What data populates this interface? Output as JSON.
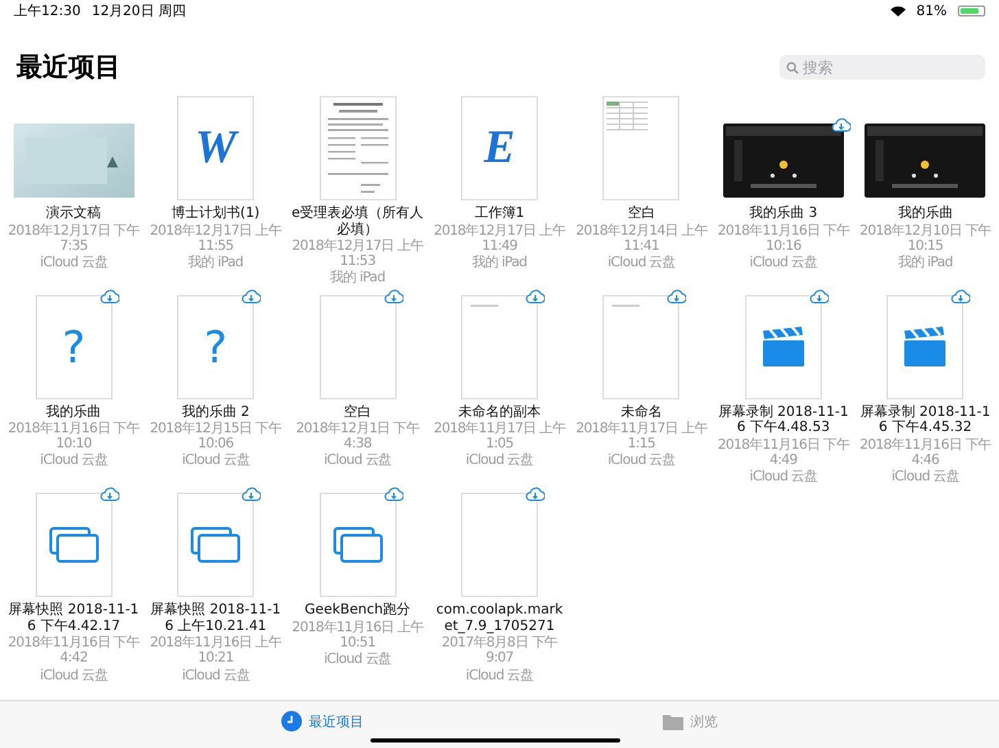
{
  "status_bar": {
    "time": "上午12:30",
    "date": "12月20日 周四",
    "battery_text": "81%"
  },
  "header": {
    "title": "最近项目",
    "search": {
      "placeholder": "搜索"
    }
  },
  "items": [
    {
      "name": "演示文稿",
      "date": "2018年12月17日 下午7:35",
      "location": "iCloud 云盘",
      "kind": "presentation",
      "cloud": false
    },
    {
      "name": "博士计划书(1)",
      "date": "2018年12月17日 上午11:55",
      "location": "我的 iPad",
      "kind": "letter",
      "glyph": "W",
      "cloud": false
    },
    {
      "name": "e受理表必填（所有人必填）",
      "date": "2018年12月17日 上午11:53",
      "location": "我的 iPad",
      "kind": "form",
      "cloud": false
    },
    {
      "name": "工作簿1",
      "date": "2018年12月17日 上午11:49",
      "location": "我的 iPad",
      "kind": "letter",
      "glyph": "E",
      "cloud": false
    },
    {
      "name": "空白",
      "date": "2018年12月14日 上午11:41",
      "location": "iCloud 云盘",
      "kind": "sheet",
      "cloud": false
    },
    {
      "name": "我的乐曲 3",
      "date": "2018年11月16日 下午10:16",
      "location": "iCloud 云盘",
      "kind": "music",
      "cloud": true
    },
    {
      "name": "我的乐曲",
      "date": "2018年12月10日 下午10:15",
      "location": "我的 iPad",
      "kind": "music",
      "cloud": false
    },
    {
      "name": "我的乐曲",
      "date": "2018年11月16日 下午10:10",
      "location": "iCloud 云盘",
      "kind": "unknown",
      "glyph": "?",
      "cloud": true
    },
    {
      "name": "我的乐曲 2",
      "date": "2018年12月15日 下午10:06",
      "location": "iCloud 云盘",
      "kind": "unknown",
      "glyph": "?",
      "cloud": true
    },
    {
      "name": "空白",
      "date": "2018年12月1日 下午4:38",
      "location": "iCloud 云盘",
      "kind": "blank",
      "cloud": true
    },
    {
      "name": "未命名的副本",
      "date": "2018年11月17日 上午1:05",
      "location": "iCloud 云盘",
      "kind": "note",
      "cloud": true
    },
    {
      "name": "未命名",
      "date": "2018年11月17日 上午1:15",
      "location": "iCloud 云盘",
      "kind": "note",
      "cloud": true
    },
    {
      "name": "屏幕录制 2018-11-16 下午4.48.53",
      "date": "2018年11月16日 下午4:49",
      "location": "iCloud 云盘",
      "kind": "video",
      "cloud": true
    },
    {
      "name": "屏幕录制 2018-11-16 下午4.45.32",
      "date": "2018年11月16日 下午4:46",
      "location": "iCloud 云盘",
      "kind": "video",
      "cloud": true
    },
    {
      "name": "屏幕快照 2018-11-16 下午4.42.17",
      "date": "2018年11月16日 下午4:42",
      "location": "iCloud 云盘",
      "kind": "image",
      "cloud": true
    },
    {
      "name": "屏幕快照 2018-11-16 上午10.21.41",
      "date": "2018年11月16日 上午10:21",
      "location": "iCloud 云盘",
      "kind": "image",
      "cloud": true
    },
    {
      "name": "GeekBench跑分",
      "date": "2018年11月16日 上午10:51",
      "location": "iCloud 云盘",
      "kind": "image",
      "cloud": true
    },
    {
      "name": "com.coolapk.market_7.9_1705271",
      "date": "2017年8月8日 下午9:07",
      "location": "iCloud 云盘",
      "kind": "blank",
      "cloud": true
    }
  ],
  "tabs": [
    {
      "label": "最近项目",
      "kind": "recents",
      "selected": true
    },
    {
      "label": "浏览",
      "kind": "browse",
      "selected": false
    }
  ]
}
